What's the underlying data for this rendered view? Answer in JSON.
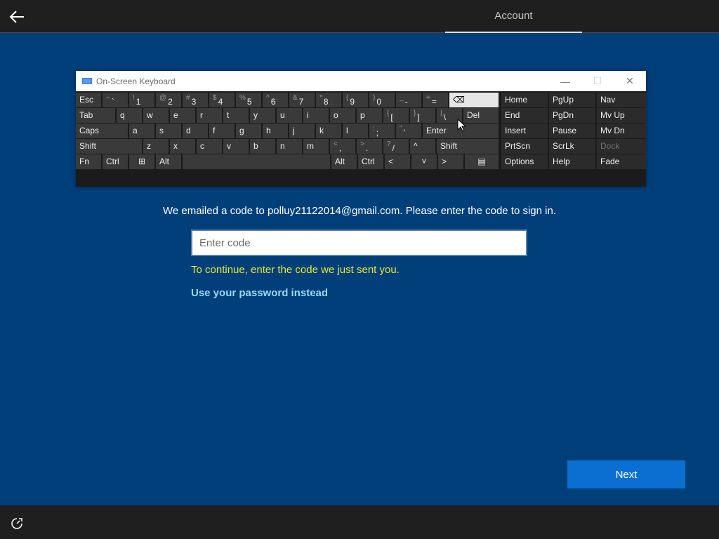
{
  "header": {
    "tab_label": "Account"
  },
  "osk": {
    "title": "On-Screen Keyboard",
    "controls": {
      "minimize": "—",
      "maximize": "☐",
      "close": "✕"
    },
    "row1": [
      {
        "label": "Esc"
      },
      {
        "sm": "~",
        "mn": "`"
      },
      {
        "sm": "!",
        "mn": "1"
      },
      {
        "sm": "@",
        "mn": "2"
      },
      {
        "sm": "#",
        "mn": "3"
      },
      {
        "sm": "$",
        "mn": "4"
      },
      {
        "sm": "%",
        "mn": "5"
      },
      {
        "sm": "^",
        "mn": "6"
      },
      {
        "sm": "&",
        "mn": "7"
      },
      {
        "sm": "*",
        "mn": "8"
      },
      {
        "sm": "(",
        "mn": "9"
      },
      {
        "sm": ")",
        "mn": "0"
      },
      {
        "sm": "_",
        "mn": "-"
      },
      {
        "sm": "+",
        "mn": "="
      },
      {
        "label": "⌫"
      }
    ],
    "row2": [
      {
        "label": "Tab"
      },
      {
        "label": "q"
      },
      {
        "label": "w"
      },
      {
        "label": "e"
      },
      {
        "label": "r"
      },
      {
        "label": "t"
      },
      {
        "label": "y"
      },
      {
        "label": "u"
      },
      {
        "label": "i"
      },
      {
        "label": "o"
      },
      {
        "label": "p"
      },
      {
        "sm": "{",
        "mn": "["
      },
      {
        "sm": "}",
        "mn": "]"
      },
      {
        "sm": "|",
        "mn": "\\"
      },
      {
        "label": "Del"
      }
    ],
    "row3": [
      {
        "label": "Caps"
      },
      {
        "label": "a"
      },
      {
        "label": "s"
      },
      {
        "label": "d"
      },
      {
        "label": "f"
      },
      {
        "label": "g"
      },
      {
        "label": "h"
      },
      {
        "label": "j"
      },
      {
        "label": "k"
      },
      {
        "label": "l"
      },
      {
        "sm": ":",
        "mn": ";"
      },
      {
        "sm": "\"",
        "mn": "'"
      },
      {
        "label": "Enter"
      }
    ],
    "row4": [
      {
        "label": "Shift"
      },
      {
        "label": "z"
      },
      {
        "label": "x"
      },
      {
        "label": "c"
      },
      {
        "label": "v"
      },
      {
        "label": "b"
      },
      {
        "label": "n"
      },
      {
        "label": "m"
      },
      {
        "sm": "<",
        "mn": ","
      },
      {
        "sm": ">",
        "mn": "."
      },
      {
        "sm": "?",
        "mn": "/"
      },
      {
        "label": "^"
      },
      {
        "label": "Shift"
      }
    ],
    "row5": [
      {
        "label": "Fn"
      },
      {
        "label": "Ctrl"
      },
      {
        "label": "⊞"
      },
      {
        "label": "Alt"
      },
      {
        "label": ""
      },
      {
        "label": "Alt"
      },
      {
        "label": "Ctrl"
      },
      {
        "label": "<"
      },
      {
        "label": "˅"
      },
      {
        "label": ">"
      },
      {
        "label": "▤"
      }
    ],
    "side": [
      [
        "Home",
        "PgUp",
        "Nav"
      ],
      [
        "End",
        "PgDn",
        "Mv Up"
      ],
      [
        "Insert",
        "Pause",
        "Mv Dn"
      ],
      [
        "PrtScn",
        "ScrLk",
        "Dock"
      ],
      [
        "Options",
        "Help",
        "Fade"
      ]
    ]
  },
  "message": "We emailed a code to polluy21122014@gmail.com. Please enter the code to sign in.",
  "code_input": {
    "placeholder": "Enter code",
    "value": ""
  },
  "hint": "To continue, enter the code we just sent you.",
  "alt_link": "Use your password instead",
  "next_button": "Next"
}
